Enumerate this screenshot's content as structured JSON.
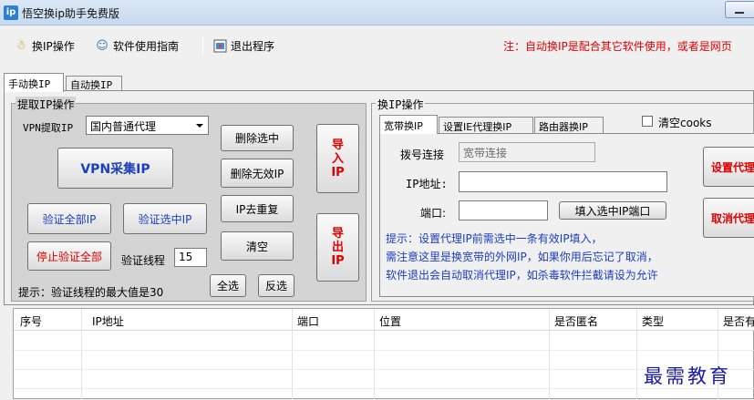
{
  "window": {
    "title": "悟空换ip助手免费版",
    "app_icon_label": "ip"
  },
  "toolbar": {
    "change_ip": "换IP操作",
    "guide": "软件使用指南",
    "exit": "退出程序",
    "notice": "注：自动换IP是配合其它软件使用，或者是网页"
  },
  "tabs": {
    "manual": "手动换IP",
    "auto": "自动换IP"
  },
  "extract": {
    "legend": "提取IP操作",
    "vpn_label": "VPN提取IP",
    "vpn_selected": "国内普通代理",
    "vpn_collect": "VPN采集IP",
    "delete_selected": "删除选中",
    "delete_invalid": "删除无效IP",
    "dedupe": "IP去重复",
    "clear": "清空",
    "verify_all": "验证全部IP",
    "verify_selected": "验证选中IP",
    "stop_verify": "停止验证全部",
    "thread_label": "验证线程",
    "thread_value": "15",
    "select_all": "全选",
    "invert": "反选",
    "import_ip": "导入IP",
    "export_ip": "导出IP",
    "hint": "提示：验证线程的最大值是30"
  },
  "change": {
    "legend": "换IP操作",
    "tab_broadband": "宽带换IP",
    "tab_ie_proxy": "设置IE代理换IP",
    "tab_router": "路由器换IP",
    "clear_cookies": "清空cooks",
    "dial_label": "拨号连接",
    "dial_value": "宽带连接",
    "ip_label": "IP地址:",
    "ip_value": "",
    "port_label": "端口:",
    "port_value": "",
    "fill_selected": "填入选中IP端口",
    "set_proxy": "设置代理",
    "cancel_proxy": "取消代理",
    "hint_line1": "提示：设置代理IP前需选中一条有效IP填入，",
    "hint_line2": "需注意这里是换宽带的外网IP，如果你用后忘记了取消，",
    "hint_line3": "软件退出会自动取消代理IP，如杀毒软件拦截请设为允许"
  },
  "table": {
    "columns": [
      "序号",
      "IP地址",
      "端口",
      "位置",
      "是否匿名",
      "类型",
      "是否有"
    ]
  },
  "watermark": "最需教育",
  "colors": {
    "notice_red": "#e00000",
    "button_blue": "#1c3fbf",
    "group_bg": "#d4d4d4"
  }
}
